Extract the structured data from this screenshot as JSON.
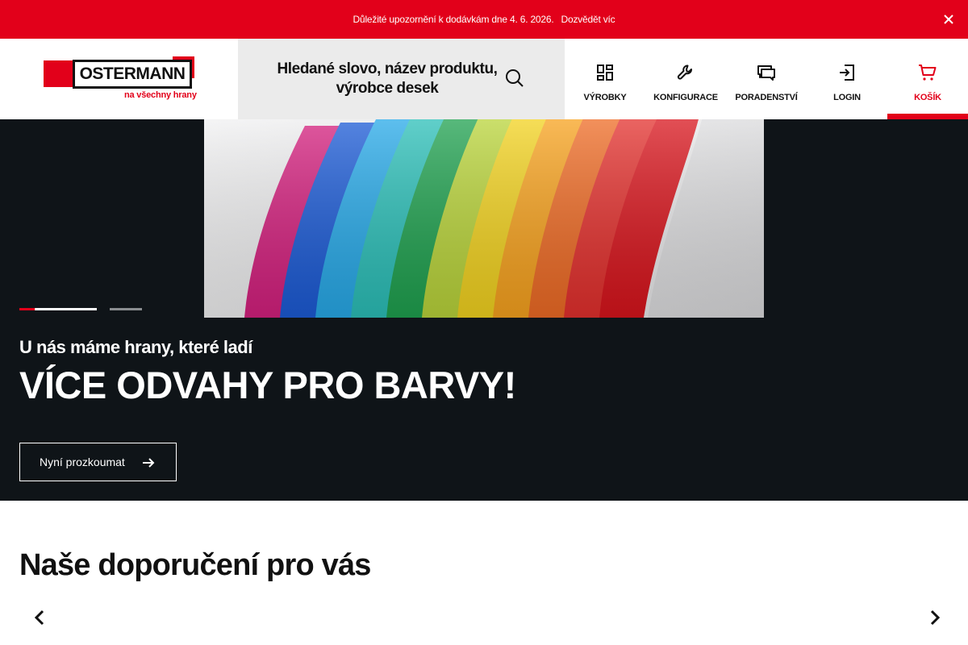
{
  "notice": {
    "text": "Důležité upozornění k dodávkám dne 4. 6. 2026.",
    "link": "Dozvědět víc"
  },
  "header": {
    "logo": {
      "wordmark": "OSTERMANN",
      "tagline": "na všechny hrany"
    },
    "search": {
      "placeholder": "Hledané slovo, název produktu, výrobce desek",
      "icon": "search-icon"
    },
    "nav": [
      {
        "label": "VÝROBKY",
        "icon": "grid-icon"
      },
      {
        "label": "KONFIGURACE",
        "icon": "wrench-icon"
      },
      {
        "label": "PORADENSTVÍ",
        "icon": "chat-icon"
      },
      {
        "label": "LOGIN",
        "icon": "login-icon"
      },
      {
        "label": "KOŠÍK",
        "icon": "cart-icon",
        "active": true
      }
    ]
  },
  "hero": {
    "subline": "U nás máme hrany, které ladí",
    "headline": "VÍCE ODVAHY PRO BARVY!",
    "cta": "Nyní prozkoumat",
    "slides": {
      "count": 2,
      "current": 1,
      "progress": 0.2
    },
    "edge_colors": [
      "#d4207e",
      "#1c5bd6",
      "#27a9e8",
      "#2bbfb8",
      "#1fa14f",
      "#b9d43a",
      "#f2d21f",
      "#f7a21e",
      "#ee6b25",
      "#e3302d",
      "#d8141c"
    ]
  },
  "recommendations": {
    "title": "Naše doporučení pro vás"
  },
  "colors": {
    "brand_red": "#e2001a",
    "hero_bg": "#0f1418",
    "search_bg": "#ebebeb"
  }
}
